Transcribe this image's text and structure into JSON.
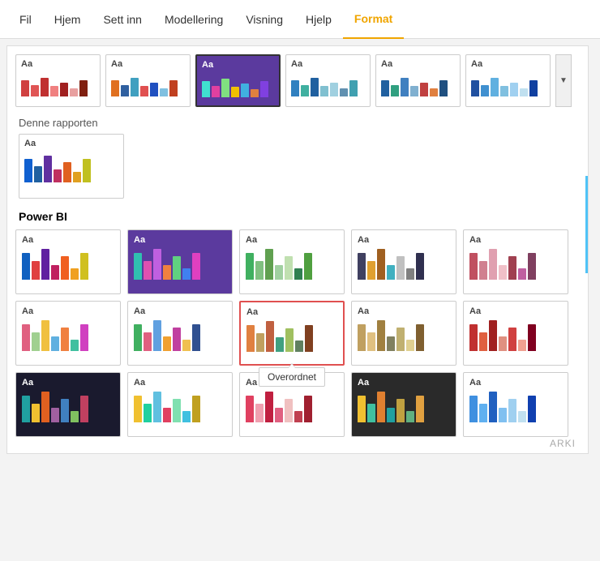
{
  "menu": {
    "items": [
      {
        "label": "Fil",
        "active": false
      },
      {
        "label": "Hjem",
        "active": false
      },
      {
        "label": "Sett inn",
        "active": false
      },
      {
        "label": "Modellering",
        "active": false
      },
      {
        "label": "Visning",
        "active": false
      },
      {
        "label": "Hjelp",
        "active": false
      },
      {
        "label": "Format",
        "active": true
      }
    ]
  },
  "top_themes": [
    {
      "aa": "Aa",
      "bars": [
        {
          "color": "#d04040",
          "height": 28
        },
        {
          "color": "#e05555",
          "height": 20
        },
        {
          "color": "#c03030",
          "height": 32
        },
        {
          "color": "#f08080",
          "height": 18
        },
        {
          "color": "#a02020",
          "height": 24
        },
        {
          "color": "#e8a0a0",
          "height": 14
        },
        {
          "color": "#802010",
          "height": 28
        }
      ],
      "bg": "#fff",
      "selected": false
    },
    {
      "aa": "Aa",
      "bars": [
        {
          "color": "#e07020",
          "height": 28
        },
        {
          "color": "#3060a0",
          "height": 20
        },
        {
          "color": "#40a0c0",
          "height": 32
        },
        {
          "color": "#e05050",
          "height": 18
        },
        {
          "color": "#2050c0",
          "height": 24
        },
        {
          "color": "#80c0e0",
          "height": 14
        },
        {
          "color": "#c04020",
          "height": 28
        }
      ],
      "bg": "#fff",
      "selected": false
    },
    {
      "aa": "Aa",
      "bars": [
        {
          "color": "#40e0d0",
          "height": 28
        },
        {
          "color": "#e040a0",
          "height": 20
        },
        {
          "color": "#80e080",
          "height": 32
        },
        {
          "color": "#f0c000",
          "height": 18
        },
        {
          "color": "#40b0e0",
          "height": 24
        },
        {
          "color": "#e08040",
          "height": 14
        },
        {
          "color": "#8040e0",
          "height": 28
        }
      ],
      "bg": "#5b3a9e",
      "selected": true
    },
    {
      "aa": "Aa",
      "bars": [
        {
          "color": "#3080c0",
          "height": 28
        },
        {
          "color": "#40b0a0",
          "height": 20
        },
        {
          "color": "#2060a0",
          "height": 32
        },
        {
          "color": "#80c0d0",
          "height": 18
        },
        {
          "color": "#a0d0e0",
          "height": 24
        },
        {
          "color": "#6090b0",
          "height": 14
        },
        {
          "color": "#40a0b0",
          "height": 28
        }
      ],
      "bg": "#fff",
      "selected": false
    },
    {
      "aa": "Aa",
      "bars": [
        {
          "color": "#2060a0",
          "height": 28
        },
        {
          "color": "#30a080",
          "height": 20
        },
        {
          "color": "#4080c0",
          "height": 32
        },
        {
          "color": "#80b0d0",
          "height": 18
        },
        {
          "color": "#c04040",
          "height": 24
        },
        {
          "color": "#e08040",
          "height": 14
        },
        {
          "color": "#205080",
          "height": 28
        }
      ],
      "bg": "#fff",
      "selected": false
    },
    {
      "aa": "Aa",
      "bars": [
        {
          "color": "#2050a0",
          "height": 28
        },
        {
          "color": "#4090d0",
          "height": 20
        },
        {
          "color": "#60b0e0",
          "height": 32
        },
        {
          "color": "#80c0e0",
          "height": 18
        },
        {
          "color": "#a0d0f0",
          "height": 24
        },
        {
          "color": "#c0e0f0",
          "height": 14
        },
        {
          "color": "#1040a0",
          "height": 28
        }
      ],
      "bg": "#fff",
      "selected": false
    }
  ],
  "section_denne": "Denne rapporten",
  "single_theme": {
    "aa": "Aa",
    "bars": [
      {
        "color": "#1060d0",
        "height": 32
      },
      {
        "color": "#2060a0",
        "height": 22
      },
      {
        "color": "#6030a0",
        "height": 36
      },
      {
        "color": "#c03060",
        "height": 18
      },
      {
        "color": "#e06020",
        "height": 28
      },
      {
        "color": "#e0a020",
        "height": 14
      },
      {
        "color": "#c0c020",
        "height": 32
      }
    ]
  },
  "section_powerbi": "Power BI",
  "powerbi_themes": [
    {
      "aa": "Aa",
      "bars": [
        {
          "color": "#1060c0",
          "height": 36
        },
        {
          "color": "#e04040",
          "height": 25
        },
        {
          "color": "#6020a0",
          "height": 42
        },
        {
          "color": "#c02060",
          "height": 20
        },
        {
          "color": "#f06020",
          "height": 32
        },
        {
          "color": "#f0a020",
          "height": 15
        },
        {
          "color": "#d0c020",
          "height": 36
        }
      ],
      "bg": "#fff"
    },
    {
      "aa": "Aa",
      "bars": [
        {
          "color": "#30c0b0",
          "height": 36
        },
        {
          "color": "#e050b0",
          "height": 25
        },
        {
          "color": "#c060e0",
          "height": 42
        },
        {
          "color": "#f08040",
          "height": 20
        },
        {
          "color": "#60d080",
          "height": 32
        },
        {
          "color": "#4080f0",
          "height": 15
        },
        {
          "color": "#e040c0",
          "height": 36
        }
      ],
      "bg": "#5b3a9e"
    },
    {
      "aa": "Aa",
      "bars": [
        {
          "color": "#40b060",
          "height": 36
        },
        {
          "color": "#80c080",
          "height": 25
        },
        {
          "color": "#60a050",
          "height": 42
        },
        {
          "color": "#a0d0a0",
          "height": 20
        },
        {
          "color": "#c0e0b0",
          "height": 32
        },
        {
          "color": "#308050",
          "height": 15
        },
        {
          "color": "#50a040",
          "height": 36
        }
      ],
      "bg": "#fff"
    },
    {
      "aa": "Aa",
      "bars": [
        {
          "color": "#404060",
          "height": 36
        },
        {
          "color": "#e0a030",
          "height": 25
        },
        {
          "color": "#a06020",
          "height": 42
        },
        {
          "color": "#40b0c0",
          "height": 20
        },
        {
          "color": "#c0c0c0",
          "height": 32
        },
        {
          "color": "#808080",
          "height": 15
        },
        {
          "color": "#303050",
          "height": 36
        }
      ],
      "bg": "#fff"
    },
    {
      "aa": "Aa",
      "bars": [
        {
          "color": "#c05060",
          "height": 36
        },
        {
          "color": "#d08090",
          "height": 25
        },
        {
          "color": "#e0a0b0",
          "height": 42
        },
        {
          "color": "#f0c0c8",
          "height": 20
        },
        {
          "color": "#a04050",
          "height": 32
        },
        {
          "color": "#c060a0",
          "height": 15
        },
        {
          "color": "#804060",
          "height": 36
        }
      ],
      "bg": "#fff"
    },
    {
      "aa": "Aa",
      "bars": [
        {
          "color": "#e06080",
          "height": 36
        },
        {
          "color": "#a0d090",
          "height": 25
        },
        {
          "color": "#f0c040",
          "height": 42
        },
        {
          "color": "#60b0e0",
          "height": 20
        },
        {
          "color": "#f08040",
          "height": 32
        },
        {
          "color": "#40c0a0",
          "height": 15
        },
        {
          "color": "#d040c0",
          "height": 36
        }
      ],
      "bg": "#fff"
    },
    {
      "aa": "Aa",
      "bars": [
        {
          "color": "#40b060",
          "height": 36
        },
        {
          "color": "#e06080",
          "height": 25
        },
        {
          "color": "#60a0e0",
          "height": 42
        },
        {
          "color": "#f0a030",
          "height": 20
        },
        {
          "color": "#c040a0",
          "height": 32
        },
        {
          "color": "#f0c050",
          "height": 15
        },
        {
          "color": "#305090",
          "height": 36
        }
      ],
      "bg": "#fff"
    },
    {
      "aa": "Aa",
      "bars": [
        {
          "color": "#e08040",
          "height": 36
        },
        {
          "color": "#c0a060",
          "height": 25
        },
        {
          "color": "#c06040",
          "height": 42
        },
        {
          "color": "#40a080",
          "height": 20
        },
        {
          "color": "#a0c060",
          "height": 32
        },
        {
          "color": "#608060",
          "height": 15
        },
        {
          "color": "#804020",
          "height": 36
        }
      ],
      "bg": "#fff",
      "selected_red": true,
      "tooltip": "Overordnet"
    },
    {
      "aa": "Aa",
      "bars": [
        {
          "color": "#c0a060",
          "height": 36
        },
        {
          "color": "#e0c080",
          "height": 25
        },
        {
          "color": "#a08040",
          "height": 42
        },
        {
          "color": "#808060",
          "height": 20
        },
        {
          "color": "#c0b070",
          "height": 32
        },
        {
          "color": "#e0d090",
          "height": 15
        },
        {
          "color": "#806030",
          "height": 36
        }
      ],
      "bg": "#fff"
    },
    {
      "aa": "Aa",
      "bars": [
        {
          "color": "#c03030",
          "height": 36
        },
        {
          "color": "#e06040",
          "height": 25
        },
        {
          "color": "#a02020",
          "height": 42
        },
        {
          "color": "#e09080",
          "height": 20
        },
        {
          "color": "#d04040",
          "height": 32
        },
        {
          "color": "#f0a090",
          "height": 15
        },
        {
          "color": "#800020",
          "height": 36
        }
      ],
      "bg": "#fff"
    },
    {
      "aa": "Aa",
      "bars": [
        {
          "color": "#20a0a0",
          "height": 36
        },
        {
          "color": "#f0c030",
          "height": 25
        },
        {
          "color": "#e06020",
          "height": 42
        },
        {
          "color": "#a060a0",
          "height": 20
        },
        {
          "color": "#4080c0",
          "height": 32
        },
        {
          "color": "#80c060",
          "height": 15
        },
        {
          "color": "#c04060",
          "height": 36
        }
      ],
      "bg": "#1a1a2e"
    },
    {
      "aa": "Aa",
      "bars": [
        {
          "color": "#f0c030",
          "height": 36
        },
        {
          "color": "#20d0a0",
          "height": 25
        },
        {
          "color": "#60c0e0",
          "height": 42
        },
        {
          "color": "#e04060",
          "height": 20
        },
        {
          "color": "#80e0b0",
          "height": 32
        },
        {
          "color": "#40c0e0",
          "height": 15
        },
        {
          "color": "#c0a020",
          "height": 36
        }
      ],
      "bg": "#fff"
    },
    {
      "aa": "Aa",
      "bars": [
        {
          "color": "#e04060",
          "height": 36
        },
        {
          "color": "#f0a0b0",
          "height": 25
        },
        {
          "color": "#c02040",
          "height": 42
        },
        {
          "color": "#e06080",
          "height": 20
        },
        {
          "color": "#f0c0c0",
          "height": 32
        },
        {
          "color": "#c04050",
          "height": 15
        },
        {
          "color": "#a02030",
          "height": 36
        }
      ],
      "bg": "#fff"
    },
    {
      "aa": "Aa",
      "bars": [
        {
          "color": "#f0c030",
          "height": 36
        },
        {
          "color": "#40c0a0",
          "height": 25
        },
        {
          "color": "#e08030",
          "height": 42
        },
        {
          "color": "#20a0a0",
          "height": 20
        },
        {
          "color": "#c0a040",
          "height": 32
        },
        {
          "color": "#60b080",
          "height": 15
        },
        {
          "color": "#e0a040",
          "height": 36
        }
      ],
      "bg": "#2a2a2a"
    },
    {
      "aa": "Aa",
      "bars": [
        {
          "color": "#4090e0",
          "height": 36
        },
        {
          "color": "#60b0f0",
          "height": 25
        },
        {
          "color": "#2060c0",
          "height": 42
        },
        {
          "color": "#80c0f0",
          "height": 20
        },
        {
          "color": "#a0d0f0",
          "height": 32
        },
        {
          "color": "#c0e0f0",
          "height": 15
        },
        {
          "color": "#1040b0",
          "height": 36
        }
      ],
      "bg": "#fff"
    }
  ],
  "tooltip_text": "Overordnet",
  "arki_label": "ARKI"
}
